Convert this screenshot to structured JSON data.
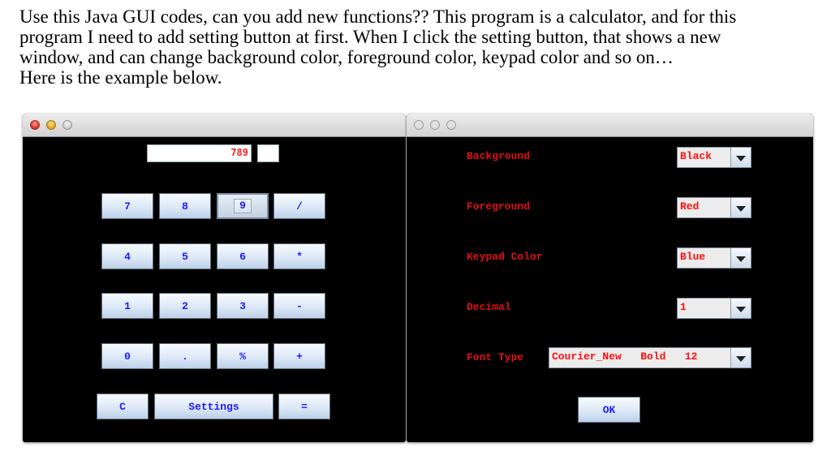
{
  "question": {
    "lines": [
      "Use this Java GUI codes, can you add new functions?? This program is a calculator, and for this",
      "program I need to add setting button at first. When I click the setting button, that shows a new",
      "window, and can change background color, foreground color, keypad color and so on…",
      "Here is the example below."
    ]
  },
  "calculator": {
    "display_value": "789",
    "memory_value": "",
    "keys": [
      [
        "7",
        "8",
        "9",
        "/"
      ],
      [
        "4",
        "5",
        "6",
        "*"
      ],
      [
        "1",
        "2",
        "3",
        "-"
      ],
      [
        "0",
        ".",
        "%",
        "+"
      ]
    ],
    "bottom": {
      "clear": "C",
      "settings": "Settings",
      "equals": "="
    },
    "colors": {
      "background": "#000000",
      "foreground": "#ff2020",
      "keypad_text": "#1a1aff"
    }
  },
  "settings": {
    "rows": [
      {
        "label": "Background",
        "value": "Black"
      },
      {
        "label": "Foreground",
        "value": "Red"
      },
      {
        "label": "Keypad Color",
        "value": "Blue"
      },
      {
        "label": "Decimal",
        "value": "1"
      },
      {
        "label": "Font Type",
        "value": "Courier_New   Bold   12"
      }
    ],
    "ok_label": "OK"
  }
}
